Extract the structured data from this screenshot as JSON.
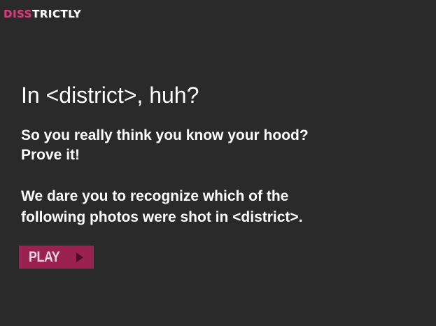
{
  "logo": {
    "part1": "DISS",
    "part2": "TRICTLY"
  },
  "main": {
    "headline": "In <district>, huh?",
    "lead_line1": "So you really think you know your hood?",
    "lead_line2": "Prove it!",
    "dare_line1": "We dare you to recognize which of the",
    "dare_line2": "following photos were shot in <district>."
  },
  "play_button": {
    "label": "PLAY",
    "icon": "play-arrow-icon"
  },
  "colors": {
    "background": "#2a2a2a",
    "accent": "#9b2150",
    "logo_pink": "#d0407a",
    "text": "#ffffff"
  }
}
